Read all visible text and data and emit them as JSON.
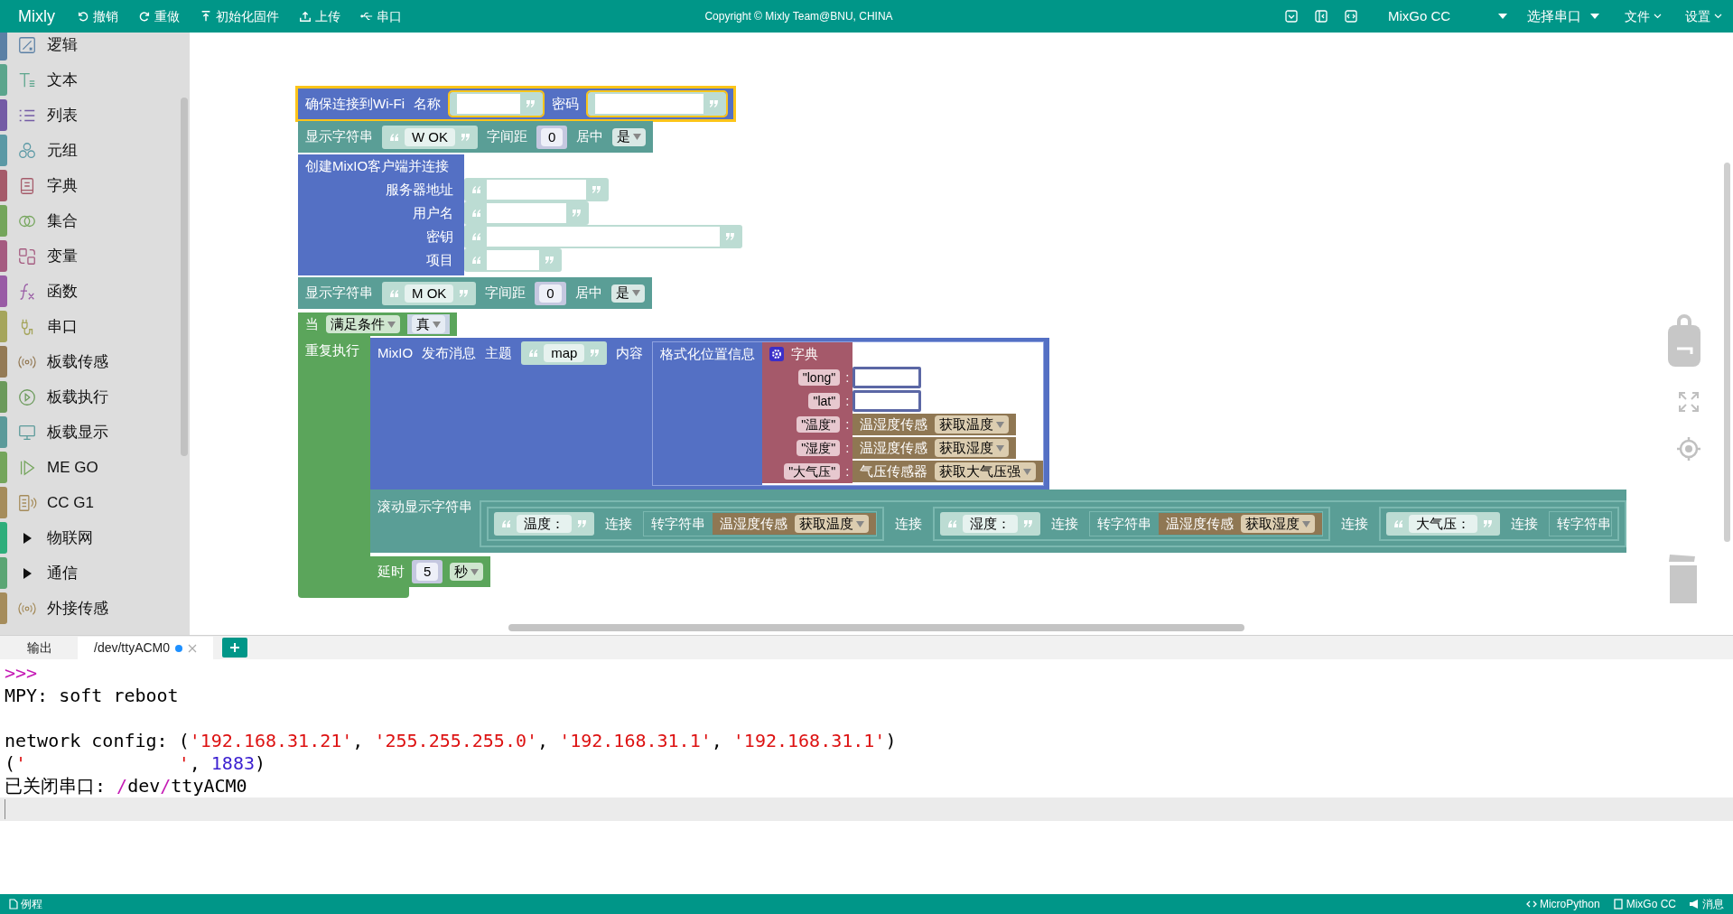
{
  "toolbar": {
    "app_name": "Mixly",
    "actions": [
      {
        "label": "撤销"
      },
      {
        "label": "重做"
      },
      {
        "label": "初始化固件"
      },
      {
        "label": "上传"
      },
      {
        "label": "串口"
      }
    ],
    "copyright": "Copyright © Mixly Team@BNU, CHINA",
    "board": "MixGo CC",
    "port": "选择串口",
    "menus": [
      "文件",
      "设置"
    ]
  },
  "sidebar": {
    "categories": [
      {
        "label": "逻辑",
        "kind": "category",
        "color": "#5b80a5"
      },
      {
        "label": "文本",
        "kind": "category",
        "color": "#5ba58c"
      },
      {
        "label": "列表",
        "kind": "category",
        "color": "#745ba5"
      },
      {
        "label": "元组",
        "kind": "category",
        "color": "#5b99a5"
      },
      {
        "label": "字典",
        "kind": "category",
        "color": "#a55b6a"
      },
      {
        "label": "集合",
        "kind": "category",
        "color": "#74a55b"
      },
      {
        "label": "变量",
        "kind": "category",
        "color": "#a55b80"
      },
      {
        "label": "函数",
        "kind": "category",
        "color": "#995ba5"
      },
      {
        "label": "串口",
        "kind": "category",
        "color": "#a5a55b"
      },
      {
        "label": "板载传感",
        "kind": "category",
        "color": "#947a55"
      },
      {
        "label": "板载执行",
        "kind": "category",
        "color": "#6b9a5b"
      },
      {
        "label": "板载显示",
        "kind": "category",
        "color": "#5b9a9a"
      },
      {
        "label": "ME GO",
        "kind": "category",
        "color": "#74a55b"
      },
      {
        "label": "CC G1",
        "kind": "category",
        "color": "#a58c5b"
      },
      {
        "label": "物联网",
        "kind": "folder",
        "color": "#2eae7b",
        "expanded": false
      },
      {
        "label": "通信",
        "kind": "folder",
        "color": "#5ba574",
        "expanded": false
      },
      {
        "label": "外接传感",
        "kind": "category",
        "color": "#a58c5b"
      }
    ]
  },
  "workspace": {
    "blocks": [
      {
        "kind": "wifi",
        "label": "确保连接到Wi-Fi",
        "name_label": "名称",
        "password_label": "密码",
        "selected": true
      },
      {
        "kind": "display",
        "label": "显示字符串",
        "text": "W OK",
        "spacing_label": "字间距",
        "spacing": "0",
        "center_label": "居中",
        "center": "是"
      },
      {
        "kind": "mixio_client",
        "label": "创建MixIO客户端并连接",
        "fields": [
          "服务器地址",
          "用户名",
          "密钥",
          "项目"
        ]
      },
      {
        "kind": "display",
        "label": "显示字符串",
        "text": "M OK",
        "spacing_label": "字间距",
        "spacing": "0",
        "center_label": "居中",
        "center": "是"
      },
      {
        "kind": "while",
        "label": "当",
        "mode": "满足条件",
        "condition": "真",
        "do_label": "重复执行",
        "body": [
          {
            "kind": "publish",
            "label": "MixIO",
            "action": "发布消息",
            "topic_label": "主题",
            "topic": "map",
            "content_label": "内容",
            "format_label": "格式化位置信息",
            "dict_label": "字典",
            "entries": [
              {
                "key": "\"long\"",
                "sep": ":",
                "kind": "blank"
              },
              {
                "key": "\"lat\"",
                "sep": ":",
                "kind": "blank"
              },
              {
                "key": "\"温度\"",
                "sep": ":",
                "kind": "sensor",
                "sensor": "温湿度传感",
                "option": "获取温度"
              },
              {
                "key": "\"湿度\"",
                "sep": ":",
                "kind": "sensor",
                "sensor": "温湿度传感",
                "option": "获取湿度"
              },
              {
                "key": "\"大气压\"",
                "sep": ":",
                "kind": "sensor",
                "sensor": "气压传感器",
                "option": "获取大气压强"
              }
            ]
          },
          {
            "kind": "scroll",
            "label": "滚动显示字符串",
            "items": [
              {
                "kind": "term",
                "text": "温度：",
                "join_label": "连接",
                "convert_label": "转字符串",
                "sensor": "温湿度传感",
                "option": "获取温度"
              },
              {
                "kind": "join",
                "label": "连接"
              },
              {
                "kind": "term",
                "text": "湿度：",
                "join_label": "连接",
                "convert_label": "转字符串",
                "sensor": "温湿度传感",
                "option": "获取湿度"
              },
              {
                "kind": "join",
                "label": "连接"
              },
              {
                "kind": "term",
                "text": "大气压：",
                "join_label": "连接",
                "convert_label": "转字符串"
              }
            ]
          },
          {
            "kind": "delay",
            "label": "延时",
            "value": "5",
            "unit": "秒"
          }
        ]
      }
    ]
  },
  "console": {
    "tabs": [
      {
        "label": "输出",
        "selected": false
      },
      {
        "label": "/dev/ttyACM0",
        "selected": true,
        "connected": true
      }
    ],
    "lines": [
      {
        "kind": "text",
        "segments": [
          {
            "kind": "prompt",
            "text": ">>>"
          }
        ]
      },
      {
        "kind": "text",
        "segments": [
          {
            "kind": "plain",
            "text": "MPY: soft reboot"
          }
        ]
      },
      {
        "kind": "blank"
      },
      {
        "kind": "text",
        "segments": [
          {
            "kind": "plain",
            "text": "network config: ("
          },
          {
            "kind": "string",
            "text": "'192.168.31.21'"
          },
          {
            "kind": "plain",
            "text": ", "
          },
          {
            "kind": "string",
            "text": "'255.255.255.0'"
          },
          {
            "kind": "plain",
            "text": ", "
          },
          {
            "kind": "string",
            "text": "'192.168.31.1'"
          },
          {
            "kind": "plain",
            "text": ", "
          },
          {
            "kind": "string",
            "text": "'192.168.31.1'"
          },
          {
            "kind": "plain",
            "text": ")"
          }
        ]
      },
      {
        "kind": "text",
        "segments": [
          {
            "kind": "plain",
            "text": "("
          },
          {
            "kind": "string",
            "text": "'              '"
          },
          {
            "kind": "plain",
            "text": ", "
          },
          {
            "kind": "number",
            "text": "1883"
          },
          {
            "kind": "plain",
            "text": ")"
          }
        ]
      },
      {
        "kind": "text",
        "segments": [
          {
            "kind": "plain",
            "text": "已关闭串口: "
          },
          {
            "kind": "prompt",
            "text": "/"
          },
          {
            "kind": "plain",
            "text": "dev"
          },
          {
            "kind": "prompt",
            "text": "/"
          },
          {
            "kind": "plain",
            "text": "ttyACM0"
          }
        ]
      }
    ]
  },
  "status_bar": {
    "left": "例程",
    "right": [
      "MicroPython",
      "MixGo CC",
      "消息"
    ]
  }
}
